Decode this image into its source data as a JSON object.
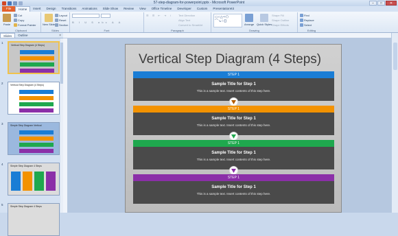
{
  "window": {
    "title": "57-step-diagram-for-powerpoint.pptx - Microsoft PowerPoint",
    "controls": [
      "–",
      "□",
      "✕"
    ]
  },
  "tabs": [
    "File",
    "Home",
    "Insert",
    "Design",
    "Transitions",
    "Animations",
    "Slide Show",
    "Review",
    "View",
    "Office Timeline",
    "Developer",
    "Custom",
    "PresentationKit"
  ],
  "ribbon": {
    "clipboard": {
      "label": "Clipboard",
      "paste": "Paste",
      "cut": "Cut",
      "copy": "Copy",
      "format_painter": "Format Painter"
    },
    "slides": {
      "label": "Slides",
      "new_slide": "New Slide",
      "layout": "Layout",
      "reset": "Reset",
      "section": "Section"
    },
    "font": {
      "label": "Font"
    },
    "paragraph": {
      "label": "Paragraph",
      "text_direction": "Text Direction",
      "align_text": "Align Text",
      "convert_smartart": "Convert to SmartArt"
    },
    "drawing": {
      "label": "Drawing",
      "arrange": "Arrange",
      "quick_styles": "Quick Styles",
      "shape_fill": "Shape Fill",
      "shape_outline": "Shape Outline",
      "shape_effects": "Shape Effects"
    },
    "editing": {
      "label": "Editing",
      "find": "Find",
      "replace": "Replace",
      "select": "Select"
    }
  },
  "pane": {
    "tabs": [
      "Slides",
      "Outline"
    ],
    "close": "×"
  },
  "thumbnails": [
    {
      "num": "1",
      "title": "Vertical Step Diagram (4 Steps)",
      "colors": [
        "#1a7dd5",
        "#f39200",
        "#1fa84e",
        "#8b2fa8"
      ]
    },
    {
      "num": "2",
      "title": "Vertical Step Diagram (4 Steps)",
      "colors": [
        "#1a7dd5",
        "#f39200",
        "#1fa84e",
        "#8b2fa8"
      ]
    },
    {
      "num": "3",
      "title": "Simple Step Diagram Vertical",
      "colors": [
        "#1a7dd5",
        "#f39200",
        "#1fa84e",
        "#8b2fa8"
      ]
    },
    {
      "num": "4",
      "title": "Simple Step Diagram 4 Steps",
      "colors": [
        "#1a7dd5",
        "#f39200",
        "#1fa84e",
        "#8b2fa8"
      ]
    },
    {
      "num": "5",
      "title": "Simple Step Diagram 4 Steps",
      "colors": []
    }
  ],
  "slide": {
    "title": "Vertical Step Diagram (4 Steps)",
    "steps": [
      {
        "label": "STEP 1",
        "title": "Sample Title for Step 1",
        "text": "This is a sample text. Insert contents of this step here.",
        "color": "#1a7dd5"
      },
      {
        "label": "STEP 1",
        "title": "Sample Title for Step 1",
        "text": "This is a sample text. Insert contents of this step here.",
        "color": "#f39200"
      },
      {
        "label": "STEP 1",
        "title": "Sample Title for Step 1",
        "text": "This is a sample text. Insert contents of this step here.",
        "color": "#1fa84e"
      },
      {
        "label": "STEP 1",
        "title": "Sample Title for Step 1",
        "text": "This is a sample text. Insert contents of this step here.",
        "color": "#8b2fa8"
      }
    ]
  }
}
